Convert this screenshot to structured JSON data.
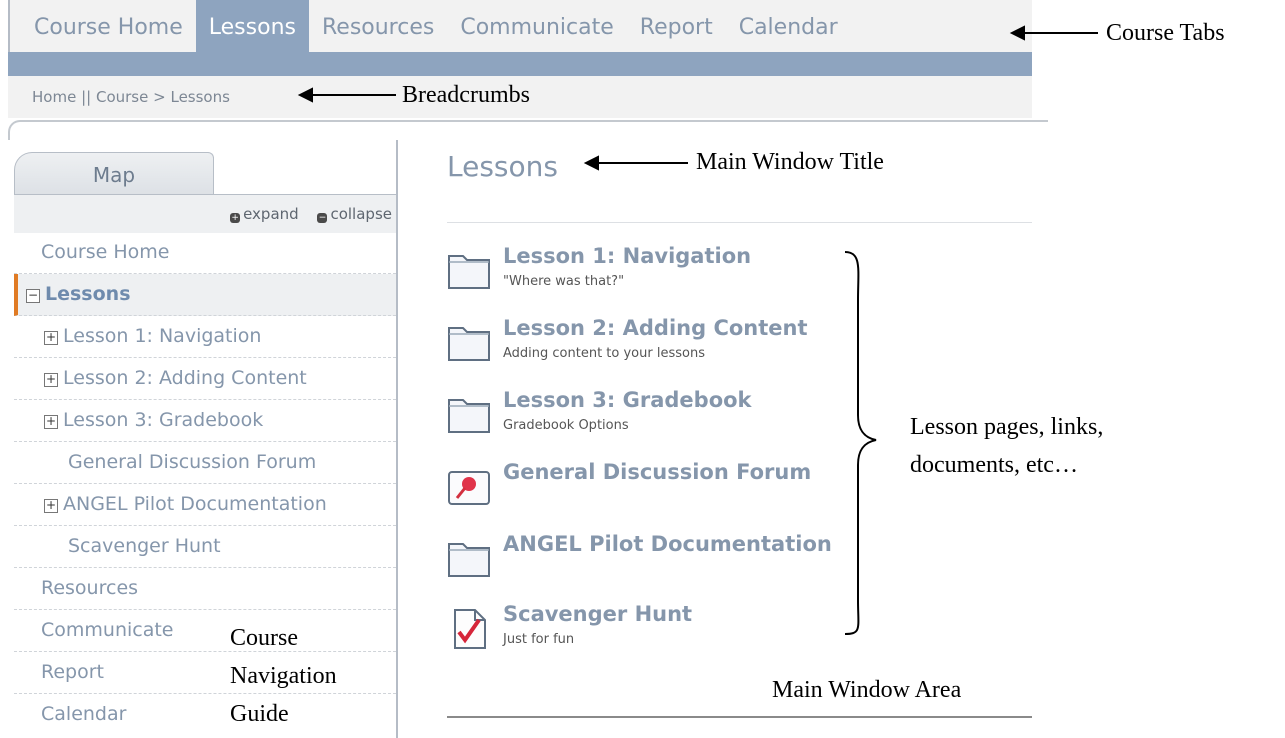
{
  "tabs": [
    {
      "label": "Course Home",
      "active": false
    },
    {
      "label": "Lessons",
      "active": true
    },
    {
      "label": "Resources",
      "active": false
    },
    {
      "label": "Communicate",
      "active": false
    },
    {
      "label": "Report",
      "active": false
    },
    {
      "label": "Calendar",
      "active": false
    }
  ],
  "breadcrumb": {
    "home": "Home",
    "sep": "||",
    "course": "Course",
    "arrow": ">",
    "current": "Lessons"
  },
  "nav": {
    "map_tab": "Map",
    "expand": "expand",
    "collapse": "collapse",
    "items": [
      {
        "label": "Course Home"
      },
      {
        "label": "Lessons",
        "toggle": "−"
      },
      {
        "label": "Lesson 1: Navigation",
        "toggle": "+"
      },
      {
        "label": "Lesson 2: Adding Content",
        "toggle": "+"
      },
      {
        "label": "Lesson 3: Gradebook",
        "toggle": "+"
      },
      {
        "label": "General Discussion Forum"
      },
      {
        "label": "ANGEL Pilot Documentation",
        "toggle": "+"
      },
      {
        "label": "Scavenger Hunt"
      },
      {
        "label": "Resources"
      },
      {
        "label": "Communicate"
      },
      {
        "label": "Report"
      },
      {
        "label": "Calendar"
      }
    ]
  },
  "main": {
    "title": "Lessons",
    "items": [
      {
        "title": "Lesson 1: Navigation",
        "desc": "\"Where was that?\"",
        "icon": "folder-icon"
      },
      {
        "title": "Lesson 2: Adding Content",
        "desc": "Adding content to your lessons",
        "icon": "folder-icon"
      },
      {
        "title": "Lesson 3: Gradebook",
        "desc": "Gradebook Options",
        "icon": "folder-icon"
      },
      {
        "title": "General Discussion Forum",
        "desc": "",
        "icon": "forum-pin-icon"
      },
      {
        "title": "ANGEL Pilot Documentation",
        "desc": "",
        "icon": "folder-icon"
      },
      {
        "title": "Scavenger Hunt",
        "desc": "Just for fun",
        "icon": "checked-document-icon"
      }
    ]
  },
  "annotations": {
    "course_tabs": "Course Tabs",
    "breadcrumbs": "Breadcrumbs",
    "main_window_title": "Main Window Title",
    "lesson_pages_1": "Lesson pages, links,",
    "lesson_pages_2": "documents, etc…",
    "course_nav_1": "Course",
    "course_nav_2": "Navigation",
    "course_nav_3": "Guide",
    "main_window_area": "Main Window Area"
  },
  "colors": {
    "tab_active": "#8ea4bf",
    "link": "#8596ab",
    "active_marker": "#e07b24"
  }
}
